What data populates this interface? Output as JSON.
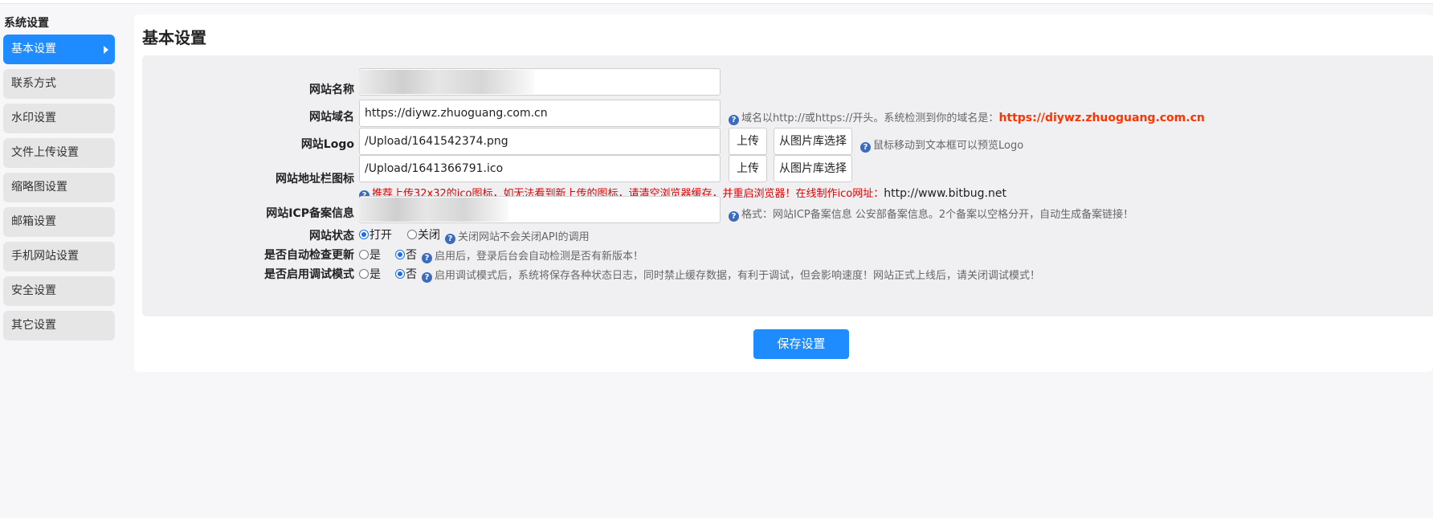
{
  "sidebar": {
    "title": "系统设置",
    "items": [
      {
        "label": "基本设置"
      },
      {
        "label": "联系方式"
      },
      {
        "label": "水印设置"
      },
      {
        "label": "文件上传设置"
      },
      {
        "label": "缩略图设置"
      },
      {
        "label": "邮箱设置"
      },
      {
        "label": "手机网站设置"
      },
      {
        "label": "安全设置"
      },
      {
        "label": "其它设置"
      }
    ]
  },
  "page": {
    "title": "基本设置"
  },
  "form": {
    "site_name": {
      "label": "网站名称"
    },
    "site_domain": {
      "label": "网站域名",
      "value": "https://diywz.zhuoguang.com.cn",
      "hint": "域名以http://或https://开头。系统检测到你的域名是：",
      "detected": "https://diywz.zhuoguang.com.cn"
    },
    "site_logo": {
      "label": "网站Logo",
      "value": "/Upload/1641542374.png",
      "upload": "上传",
      "gallery": "从图片库选择",
      "hint": "鼠标移动到文本框可以预览Logo"
    },
    "favicon": {
      "label": "网站地址栏图标",
      "value": "/Upload/1641366791.ico",
      "upload": "上传",
      "gallery": "从图片库选择",
      "hint": "推荐上传32x32的ico图标，如无法看到新上传的图标，请清空浏览器缓存，并重启浏览器！在线制作ico网址：",
      "link": "http://www.bitbug.net"
    },
    "icp": {
      "label": "网站ICP备案信息",
      "hint": "格式：网站ICP备案信息 公安部备案信息。2个备案以空格分开，自动生成备案链接！"
    },
    "status": {
      "label": "网站状态",
      "option_on": "打开",
      "option_off": "关闭",
      "hint": "关闭网站不会关闭API的调用"
    },
    "auto_update": {
      "label": "是否自动检查更新",
      "option_yes": "是",
      "option_no": "否",
      "hint": "启用后，登录后台会自动检测是否有新版本！"
    },
    "debug": {
      "label": "是否启用调试模式",
      "option_yes": "是",
      "option_no": "否",
      "hint": "启用调试模式后，系统将保存各种状态日志，同时禁止缓存数据，有利于调试，但会影响速度！网站正式上线后，请关闭调试模式！"
    },
    "save_label": "保存设置"
  },
  "icons": {
    "help": "help-icon",
    "arrow": "chevron-right-icon"
  },
  "colors": {
    "accent": "#1e8cff",
    "warning": "#e30000",
    "highlight": "#ff3300"
  }
}
